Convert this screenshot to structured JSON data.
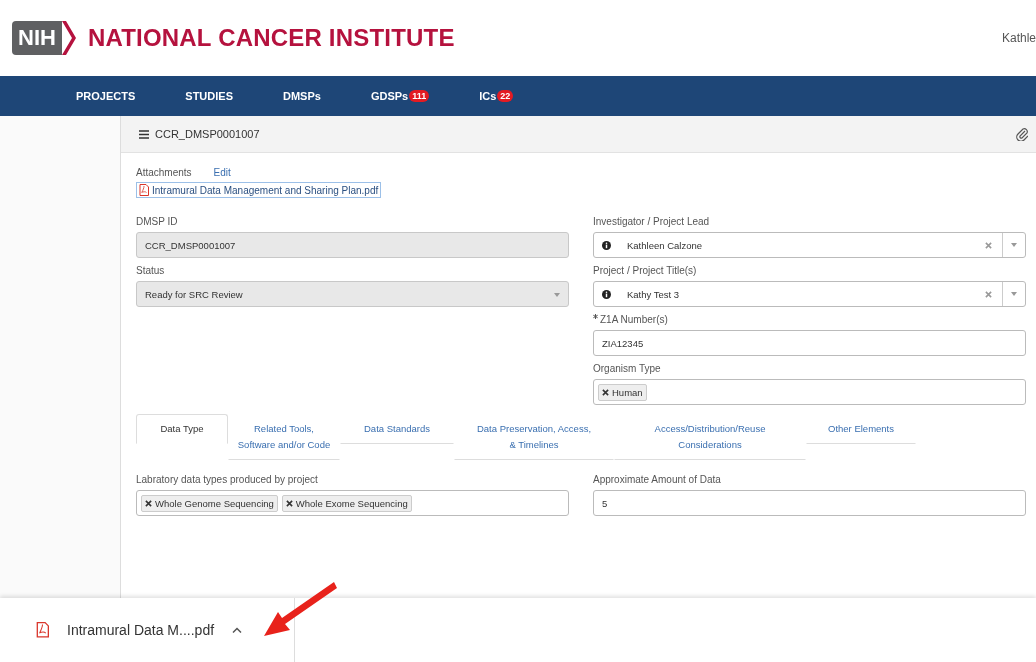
{
  "header": {
    "logo_badge": "NIH",
    "logo_title": "NATIONAL CANCER INSTITUTE",
    "user": "Kathle"
  },
  "nav": [
    {
      "label": "PROJECTS"
    },
    {
      "label": "STUDIES"
    },
    {
      "label": "DMSPs"
    },
    {
      "label": "GDSPs",
      "count": "111"
    },
    {
      "label": "ICs",
      "count": "22"
    }
  ],
  "panel": {
    "title": "CCR_DMSP0001007"
  },
  "attachments": {
    "label": "Attachments",
    "edit": "Edit",
    "file": "Intramural Data Management and Sharing Plan.pdf"
  },
  "left_fields": [
    {
      "kind": "text",
      "label": "DMSP ID",
      "value": "CCR_DMSP0001007",
      "disabled": true
    },
    {
      "kind": "select",
      "label": "Status",
      "value": "Ready for SRC Review",
      "disabled": true
    }
  ],
  "right_fields": [
    {
      "kind": "lookup",
      "label": "Investigator / Project Lead",
      "value": "Kathleen Calzone",
      "required": false
    },
    {
      "kind": "lookup",
      "label": "Project / Project Title(s)",
      "value": "Kathy Test 3",
      "required": false
    },
    {
      "kind": "text",
      "label": "Z1A Number(s)",
      "value": "ZIA12345",
      "required": true
    },
    {
      "kind": "tags",
      "label": "Organism Type",
      "tags": [
        "Human"
      ],
      "required": false
    }
  ],
  "tabs": [
    {
      "label": "Data Type",
      "selected": true
    },
    {
      "label": "Related Tools,\nSoftware and/or Code",
      "selected": false
    },
    {
      "label": "Data Standards",
      "selected": false
    },
    {
      "label": "Data Preservation, Access,\n& Timelines",
      "selected": false
    },
    {
      "label": "Access/Distribution/Reuse\nConsiderations",
      "selected": false
    },
    {
      "label": "Other Elements",
      "selected": false
    }
  ],
  "tab_fields": [
    {
      "kind": "tags",
      "label": "Labratory data types produced by project",
      "tags": [
        "Whole Genome Sequencing",
        "Whole Exome Sequencing"
      ]
    },
    {
      "kind": "text",
      "label": "Approximate Amount of Data",
      "value": "5"
    }
  ],
  "download_bar": {
    "file": "Intramural Data M....pdf"
  }
}
